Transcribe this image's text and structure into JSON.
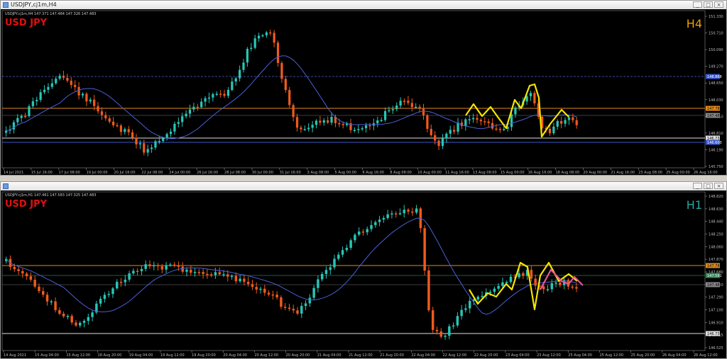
{
  "colors": {
    "bg": "#000000",
    "bull": "#26c6b6",
    "bear": "#ef5a1c",
    "ma": "#4a5fd6",
    "swingY": "#f5e400",
    "swingP": "#e8559a",
    "hl_orange": "#e08a1e",
    "hl_white": "#e0e0e0",
    "hl_blue": "#3a56c8",
    "symbol": "#e01010",
    "tfH4": "#f0a000",
    "tfH1": "#26a8a0"
  },
  "top": {
    "title_bar": "USDJPY,cj1m,H4",
    "info": "USDJPY.cj1m,H4  147.371 147.484 147.326 147.483",
    "symbol": "USD JPY",
    "timeframe": "H4",
    "price_labels": [
      "151.330",
      "150.710",
      "150.090",
      "149.270",
      "148.650",
      "148.030",
      "147.350",
      "146.810",
      "146.190",
      "145.750"
    ],
    "hl_labels": {
      "orange": "147.782",
      "white": "146.731",
      "blue": "146.600",
      "grey1": "148.868",
      "grey2": "147.483"
    },
    "time_labels": [
      "14 Jul 2021",
      "15 Jul 16:00",
      "17 Jul 08:00",
      "19 Jul 00:00",
      "20 Jul 16:00",
      "22 Jul 08:00",
      "24 Jul 00:00",
      "26 Jul 16:00",
      "28 Jul 08:00",
      "30 Jul 00:00",
      "31 Jul 16:00",
      "3 Aug 08:00",
      "5 Aug 00:00",
      "6 Aug 16:00",
      "8 Aug 08:00",
      "10 Aug 00:00",
      "11 Aug 16:00",
      "13 Aug 08:00",
      "15 Aug 00:00",
      "16 Aug 16:00",
      "18 Aug 08:00",
      "20 Aug 00:00",
      "21 Aug 16:00",
      "23 Aug 08:00",
      "25 Aug 00:00",
      "26 Aug 16:00"
    ]
  },
  "bottom": {
    "title_bar": "",
    "info": "USDJPY.cj1m,H1  147.461 147.583 147.325 147.483",
    "symbol": "USD JPY",
    "timeframe": "H1",
    "price_labels": [
      "148.820",
      "148.630",
      "148.440",
      "148.250",
      "148.060",
      "147.870",
      "147.680",
      "147.490",
      "147.290",
      "147.100",
      "146.910",
      "146.715",
      "146.525"
    ],
    "hl_labels": {
      "orange": "147.782",
      "white": "146.731",
      "green": "147.591",
      "grey": "147.483"
    },
    "time_labels": [
      "14 Aug 2021",
      "15 Aug 04:00",
      "15 Aug 12:00",
      "18 Aug 20:00",
      "19 Aug 04:00",
      "19 Aug 12:00",
      "19 Aug 20:00",
      "20 Aug 04:00",
      "20 Aug 12:00",
      "20 Aug 20:00",
      "21 Aug 04:00",
      "21 Aug 12:00",
      "21 Aug 20:00",
      "22 Aug 04:00",
      "22 Aug 12:00",
      "22 Aug 20:00",
      "23 Aug 04:00",
      "23 Aug 12:00",
      "25 Aug 04:00",
      "25 Aug 12:00",
      "25 Aug 20:00",
      "26 Aug 04:00",
      "26 Aug 12:00"
    ]
  }
}
